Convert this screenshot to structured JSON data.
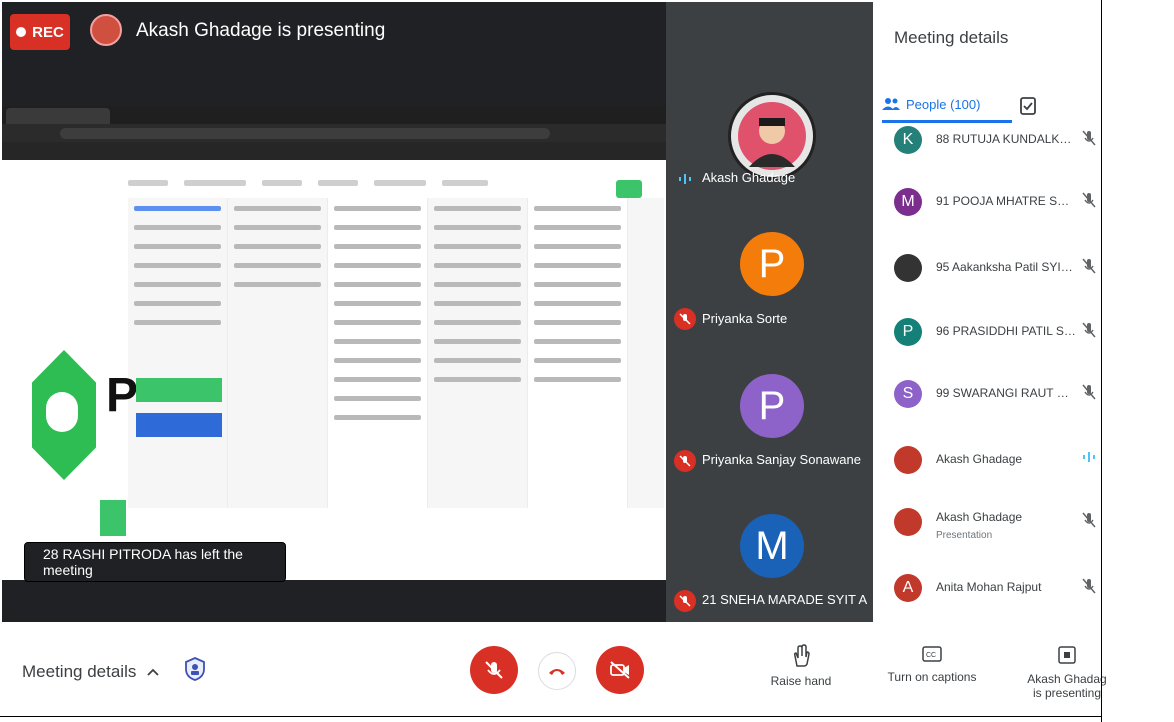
{
  "recording": {
    "label": "REC"
  },
  "header": {
    "presenting_title": "Akash Ghadage is presenting"
  },
  "toast": {
    "message": "28 RASHI PITRODA has left the meeting"
  },
  "tiles": [
    {
      "name": "Akash Ghadage",
      "initial": "",
      "color": "#c0392b",
      "speaking": true
    },
    {
      "name": "Priyanka Sorte",
      "initial": "P",
      "color": "#f47c0b",
      "speaking": false
    },
    {
      "name": "Priyanka Sanjay Sonawane",
      "initial": "P",
      "color": "#8e63c9",
      "speaking": false
    },
    {
      "name": "21 SNEHA MARADE SYIT A",
      "initial": "M",
      "color": "#1a62b8",
      "speaking": false
    }
  ],
  "panel": {
    "title": "Meeting details",
    "people_tab_label": "People (100)",
    "people": [
      {
        "name": "88 RUTUJA KUNDALKA...",
        "sub": "",
        "initial": "K",
        "color": "#26807a"
      },
      {
        "name": "91 POOJA MHATRE SYIT...",
        "sub": "",
        "initial": "M",
        "color": "#7b2e8e"
      },
      {
        "name": "95 Aakanksha Patil SYIT-B",
        "sub": "",
        "initial": "",
        "color": "#333333"
      },
      {
        "name": "96 PRASIDDHI PATIL SY-...",
        "sub": "",
        "initial": "P",
        "color": "#148077"
      },
      {
        "name": "99 SWARANGI RAUT SYI...",
        "sub": "",
        "initial": "S",
        "color": "#8e63c9"
      },
      {
        "name": "Akash Ghadage",
        "sub": "",
        "initial": "",
        "color": "#c0392b"
      },
      {
        "name": "Akash Ghadage",
        "sub": "Presentation",
        "initial": "",
        "color": "#c0392b"
      },
      {
        "name": "Anita Mohan Rajput",
        "sub": "",
        "initial": "A",
        "color": "#c0392b"
      }
    ]
  },
  "bottom": {
    "meeting_details_label": "Meeting details",
    "raise_hand_label": "Raise hand",
    "captions_label": "Turn on captions",
    "presenting_label_line1": "Akash Ghadag",
    "presenting_label_line2": "is presenting"
  },
  "colors": {
    "accent": "#1a73e8",
    "danger": "#d93025",
    "stage": "#202124",
    "tile_bg": "#3c4043"
  }
}
